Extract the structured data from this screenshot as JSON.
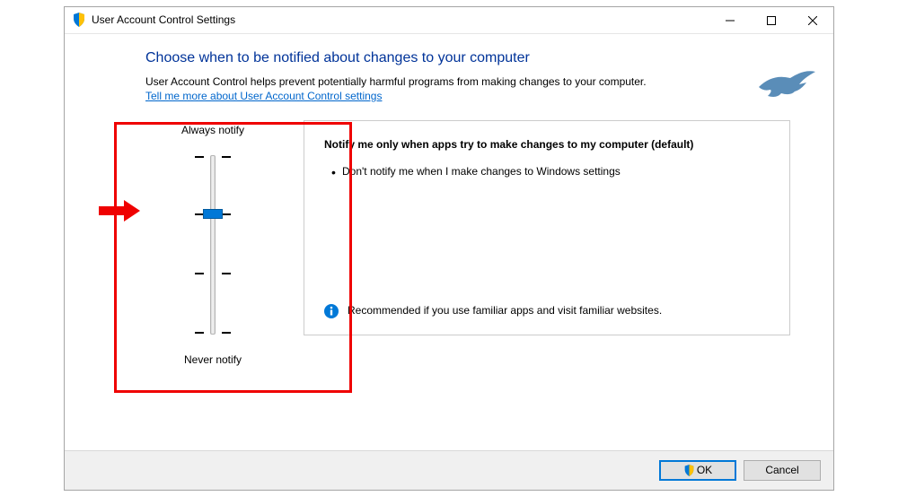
{
  "titlebar": {
    "title": "User Account Control Settings"
  },
  "page": {
    "heading": "Choose when to be notified about changes to your computer",
    "description": "User Account Control helps prevent potentially harmful programs from making changes to your computer.",
    "link_text": "Tell me more about User Account Control settings"
  },
  "slider": {
    "top_label": "Always notify",
    "bottom_label": "Never notify"
  },
  "info": {
    "title": "Notify me only when apps try to make changes to my computer (default)",
    "bullet": "Don't notify me when I make changes to Windows settings",
    "recommendation": "Recommended if you use familiar apps and visit familiar websites."
  },
  "buttons": {
    "ok": "OK",
    "cancel": "Cancel"
  }
}
